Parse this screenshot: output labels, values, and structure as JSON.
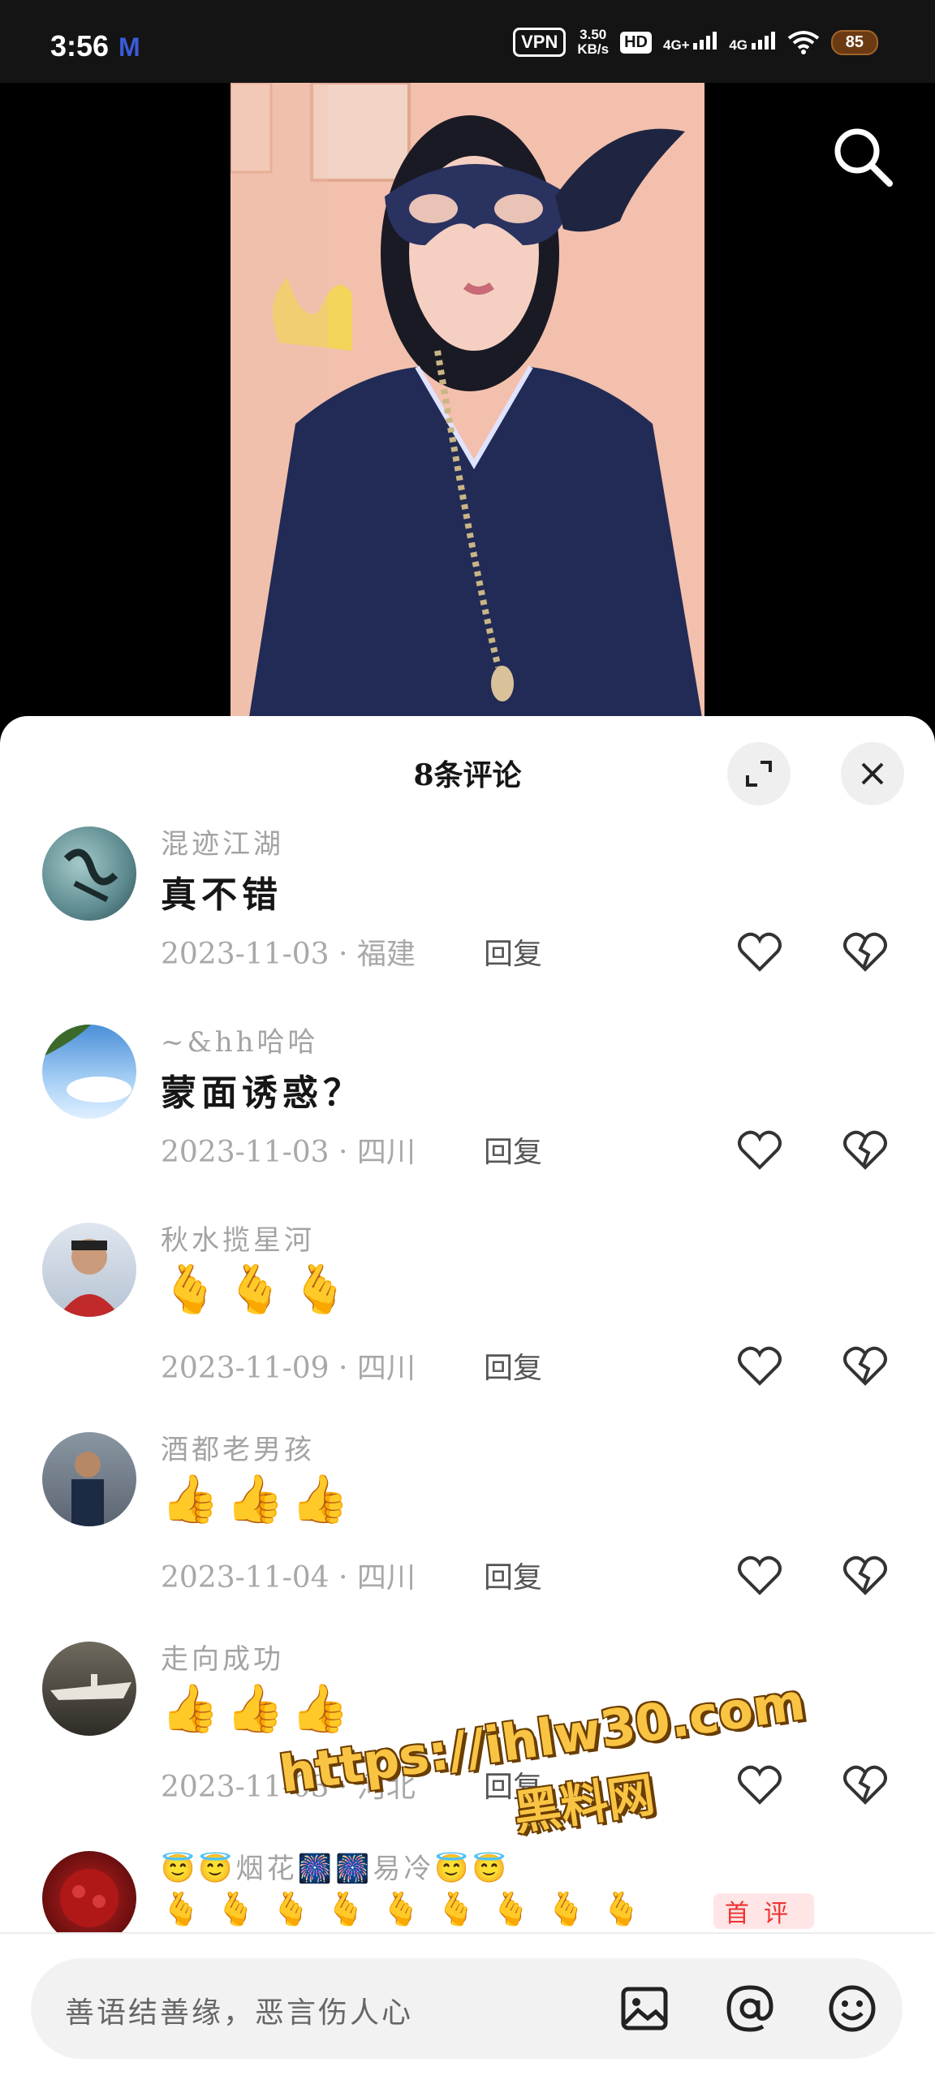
{
  "status_bar": {
    "time": "3:56",
    "carrier_icon": "M",
    "vpn": "VPN",
    "speed_value": "3.50",
    "speed_unit": "KB/s",
    "hd": "HD",
    "net1": "4G+",
    "net2": "4G",
    "battery": "85"
  },
  "video": {
    "search_icon": "search-icon"
  },
  "comments_sheet": {
    "title": "8条评论",
    "comments": [
      {
        "name": "混迹江湖",
        "text": "真不错",
        "date": "2023-11-03 · 福建",
        "reply": "回复"
      },
      {
        "name": "~&hh哈哈",
        "text": "蒙面诱惑？",
        "date": "2023-11-03 · 四川",
        "reply": "回复"
      },
      {
        "name": "秋水揽星河",
        "text": "🫰🫰🫰",
        "date": "2023-11-09 · 四川",
        "reply": "回复"
      },
      {
        "name": "酒都老男孩",
        "text": "👍👍👍",
        "date": "2023-11-04 · 四川",
        "reply": "回复"
      },
      {
        "name": "走向成功",
        "text": "👍👍👍",
        "date": "2023-11-03 · 河北",
        "reply": "回复"
      },
      {
        "name": "😇😇烟花🎆🎆易冷😇😇",
        "text": "🫰🫰🫰🫰🫰🫰🫰🫰🫰",
        "badge": "首评"
      }
    ]
  },
  "watermark": {
    "url": "https://ihlw30.com",
    "name": "黑料网"
  },
  "input_bar": {
    "placeholder": "善语结善缘，恶言伤人心"
  },
  "colors": {
    "accent_red": "#e33333",
    "sheet_bg": "#ffffff",
    "muted_text": "#a3a3a3"
  }
}
